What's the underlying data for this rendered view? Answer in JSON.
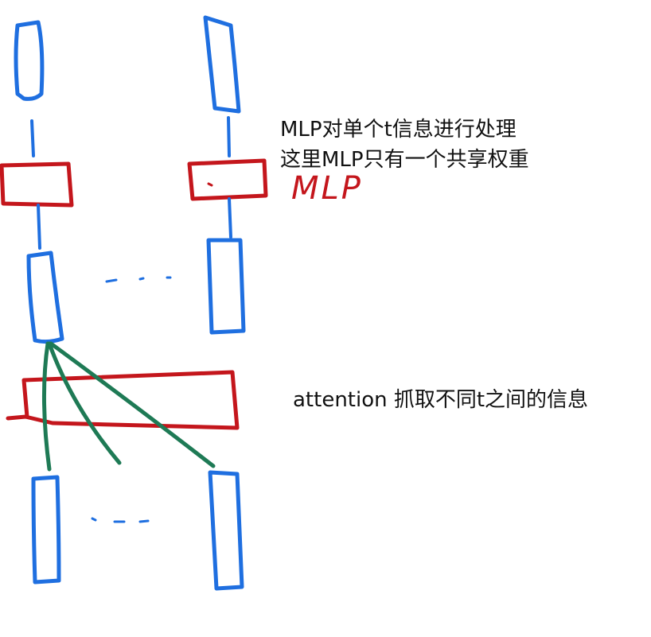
{
  "annotations": {
    "mlp_line1": "MLP对单个t信息进行处理",
    "mlp_line2": "这里MLP只有一个共享权重",
    "attention": "attention 抓取不同t之间的信息"
  },
  "handwritten": {
    "mlp_label": "MLP"
  },
  "colors": {
    "token_blue": "#1f6fe0",
    "layer_red": "#c4161c",
    "attention_green": "#1e7a55",
    "text": "#111111"
  }
}
